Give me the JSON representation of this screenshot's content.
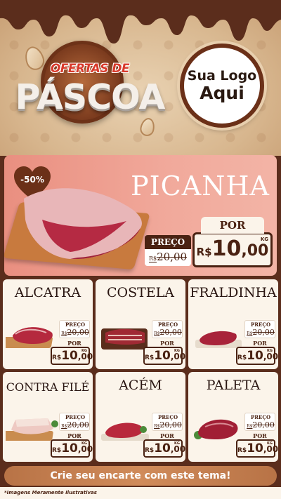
{
  "header": {
    "title_small": "OFERTAS DE",
    "title_big": "PÁSCOA",
    "logo_line1": "Sua Logo",
    "logo_line2": "Aqui"
  },
  "hero": {
    "name": "PICANHA",
    "discount": "-50%",
    "preco_label": "PREÇO",
    "old_currency": "R$",
    "old_int": "20",
    "old_dec": ",00",
    "por_label": "POR",
    "new_currency": "R$",
    "new_int": "10",
    "new_dec": ",00",
    "unit": "KG"
  },
  "products": [
    {
      "name": "ALCATRA",
      "preco_label": "PREÇO",
      "old_currency": "R$",
      "old_int": "20",
      "old_dec": ",00",
      "por_label": "POR",
      "new_currency": "R$",
      "new_int": "10",
      "new_dec": ",00",
      "unit": "KG"
    },
    {
      "name": "COSTELA",
      "preco_label": "PREÇO",
      "old_currency": "R$",
      "old_int": "20",
      "old_dec": ",00",
      "por_label": "POR",
      "new_currency": "R$",
      "new_int": "10",
      "new_dec": ",00",
      "unit": "KG"
    },
    {
      "name": "FRALDINHA",
      "preco_label": "PREÇO",
      "old_currency": "R$",
      "old_int": "20",
      "old_dec": ",00",
      "por_label": "POR",
      "new_currency": "R$",
      "new_int": "10",
      "new_dec": ",00",
      "unit": "KG"
    },
    {
      "name": "CONTRA FILÉ",
      "preco_label": "PREÇO",
      "old_currency": "R$",
      "old_int": "20",
      "old_dec": ",00",
      "por_label": "POR",
      "new_currency": "R$",
      "new_int": "10",
      "new_dec": ",00",
      "unit": "KG"
    },
    {
      "name": "ACÉM",
      "preco_label": "PREÇO",
      "old_currency": "R$",
      "old_int": "20",
      "old_dec": ",00",
      "por_label": "POR",
      "new_currency": "R$",
      "new_int": "10",
      "new_dec": ",00",
      "unit": "KG"
    },
    {
      "name": "PALETA",
      "preco_label": "PREÇO",
      "old_currency": "R$",
      "old_int": "20",
      "old_dec": ",00",
      "por_label": "POR",
      "new_currency": "R$",
      "new_int": "10",
      "new_dec": ",00",
      "unit": "KG"
    }
  ],
  "cta": "Crie seu encarte com este tema!",
  "footer": "*Imagens Meramente Ilustrativas",
  "colors": {
    "chocolate": "#5b2d1c",
    "dark_brown": "#4a2212",
    "hero_pink": "#f1a99b",
    "card_cream": "#fbf4ea",
    "cta_caramel": "#c7804f"
  }
}
